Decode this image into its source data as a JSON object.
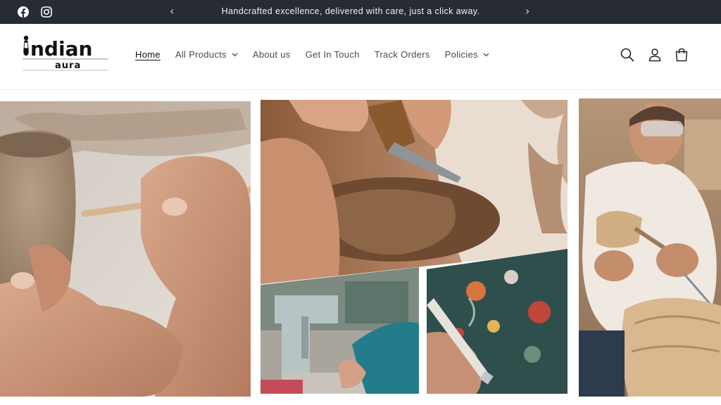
{
  "announcement": {
    "message": "Handcrafted excellence, delivered with care, just a click away.",
    "prev_icon": "chevron-left-icon",
    "next_icon": "chevron-right-icon",
    "social": [
      "facebook-icon",
      "instagram-icon"
    ]
  },
  "logo": {
    "text_main": "ndian",
    "text_sub": "aura"
  },
  "nav": {
    "items": [
      {
        "label": "Home",
        "active": true,
        "dropdown": false
      },
      {
        "label": "All Products",
        "active": false,
        "dropdown": true
      },
      {
        "label": "About us",
        "active": false,
        "dropdown": false
      },
      {
        "label": "Get In Touch",
        "active": false,
        "dropdown": false
      },
      {
        "label": "Track Orders",
        "active": false,
        "dropdown": false
      },
      {
        "label": "Policies",
        "active": false,
        "dropdown": true
      }
    ]
  },
  "header_icons": [
    "search-icon",
    "account-icon",
    "cart-icon"
  ],
  "hero": {
    "images": [
      "pottery-photo",
      "wood-carving-photo",
      "sewing-photo",
      "painting-photo",
      "craftsman-photo"
    ]
  },
  "colors": {
    "announcement_bg": "#272b34",
    "text_primary": "#121212",
    "nav_text": "#4a4a4a"
  }
}
